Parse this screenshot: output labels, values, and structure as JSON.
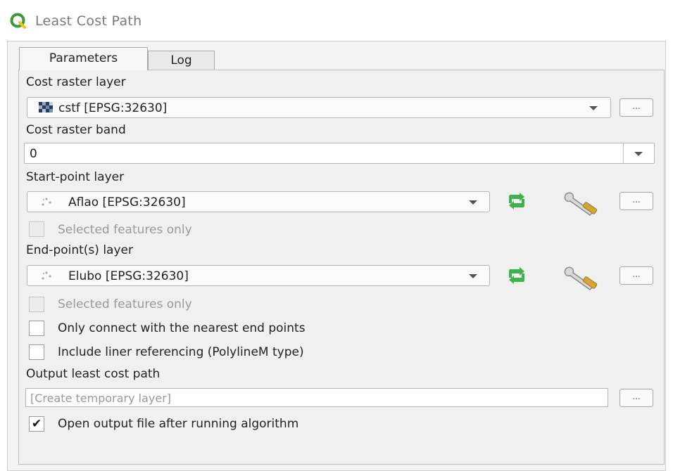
{
  "window": {
    "title": "Least Cost Path",
    "icon": "qgis-logo-icon"
  },
  "tabs": [
    {
      "label": "Parameters"
    },
    {
      "label": "Log"
    }
  ],
  "params": {
    "cost_raster_layer": {
      "label": "Cost raster layer",
      "value": "cstf [EPSG:32630]"
    },
    "cost_raster_band": {
      "label": "Cost raster band",
      "value": "0"
    },
    "start_point_layer": {
      "label": "Start-point layer",
      "value": "Aflao [EPSG:32630]",
      "selected_only": "Selected features only"
    },
    "end_point_layer": {
      "label": "End-point(s) layer",
      "value": "Elubo [EPSG:32630]",
      "selected_only": "Selected features only"
    },
    "nearest_end_points": {
      "label": "Only connect with the nearest end points",
      "checked": false
    },
    "liner_referencing": {
      "label": "Include liner referencing (PolylineM type)",
      "checked": false
    },
    "output": {
      "label": "Output least cost path",
      "placeholder": "[Create temporary layer]"
    },
    "open_output": {
      "label": "Open output file after running algorithm",
      "checked": true,
      "check_glyph": "✔"
    },
    "dots": "..."
  },
  "colors": {
    "iterate_icon": "#3fb14d",
    "wrench_icon": "#d4a534",
    "qgis_green": "#3a9a3a",
    "qgis_yellow": "#f0c419"
  }
}
